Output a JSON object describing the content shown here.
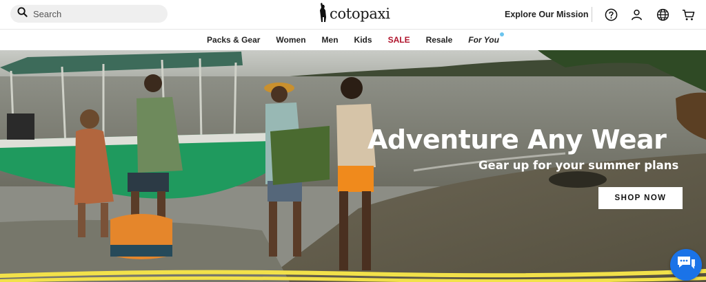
{
  "search": {
    "placeholder": "Search"
  },
  "brand": {
    "name": "cotopaxi"
  },
  "header": {
    "mission_link": "Explore Our Mission"
  },
  "icons": [
    "search-icon",
    "llama-logo-icon",
    "help-icon",
    "account-icon",
    "globe-icon",
    "cart-icon",
    "chat-icon"
  ],
  "nav": {
    "packs": "Packs & Gear",
    "women": "Women",
    "men": "Men",
    "kids": "Kids",
    "sale": "SALE",
    "resale": "Resale",
    "for_you": "For You"
  },
  "hero": {
    "headline": "Adventure Any Wear",
    "subheadline": "Gear up for your summer plans",
    "cta": "SHOP NOW"
  },
  "colors": {
    "sale": "#b0142c",
    "chat": "#1a73e8",
    "boat": "#1f9a5e",
    "stripe": "#f2e14a"
  }
}
